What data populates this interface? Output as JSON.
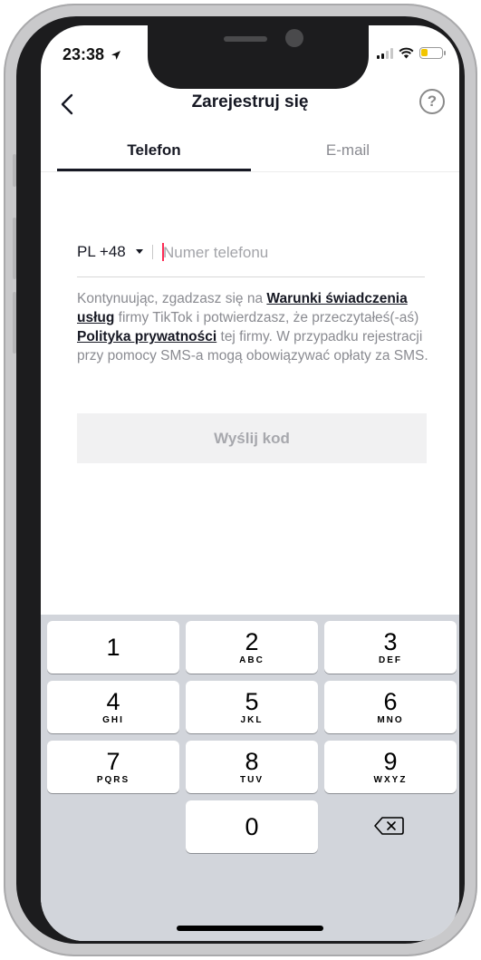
{
  "status_bar": {
    "time": "23:38"
  },
  "header": {
    "title": "Zarejestruj się",
    "back_icon": "chevron-left-icon",
    "help_icon": "question-circle-icon",
    "help_glyph": "?"
  },
  "tabs": [
    {
      "label": "Telefon",
      "active": true
    },
    {
      "label": "E-mail",
      "active": false
    }
  ],
  "phone_input": {
    "country_code": "PL +48",
    "placeholder": "Numer telefonu",
    "value": ""
  },
  "legal": {
    "part1": "Kontynuując, zgadzasz się na ",
    "terms_link": "Warunki świadczenia usług",
    "part2": " firmy TikTok i potwierdzasz, że przeczytałeś(-aś) ",
    "privacy_link": "Polityka prywatności",
    "part3": " tej firmy. W przypadku rejestracji przy pomocy SMS-a mogą obowiązywać opłaty za SMS."
  },
  "send_button": {
    "label": "Wyślij kod",
    "enabled": false
  },
  "keyboard": {
    "keys": [
      {
        "digit": "1",
        "letters": ""
      },
      {
        "digit": "2",
        "letters": "ABC"
      },
      {
        "digit": "3",
        "letters": "DEF"
      },
      {
        "digit": "4",
        "letters": "GHI"
      },
      {
        "digit": "5",
        "letters": "JKL"
      },
      {
        "digit": "6",
        "letters": "MNO"
      },
      {
        "digit": "7",
        "letters": "PQRS"
      },
      {
        "digit": "8",
        "letters": "TUV"
      },
      {
        "digit": "9",
        "letters": "WXYZ"
      },
      {
        "digit": "0",
        "letters": ""
      }
    ],
    "delete_icon": "backspace-icon"
  },
  "colors": {
    "accent_cursor": "#fe2c55",
    "text_primary": "#161823",
    "text_secondary": "#8a8b91",
    "keyboard_bg": "#d2d5db"
  }
}
